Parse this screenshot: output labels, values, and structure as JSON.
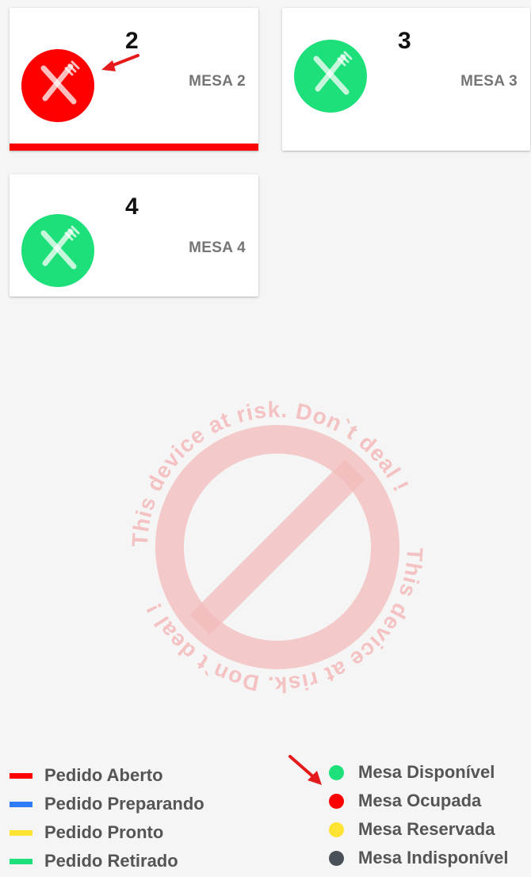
{
  "tables": [
    {
      "number": "2",
      "label": "MESA 2",
      "status_color": "#ff0000",
      "order_bar_color": "#ff0000",
      "icon": "fork-knife-icon"
    },
    {
      "number": "3",
      "label": "MESA 3",
      "status_color": "#1de07a",
      "icon": "fork-knife-icon"
    },
    {
      "number": "4",
      "label": "MESA 4",
      "status_color": "#1de07a",
      "icon": "fork-knife-icon"
    }
  ],
  "watermark": {
    "text": "This device at risk. Don`t deal !",
    "icon": "prohibited-icon",
    "color": "#f3b9b9"
  },
  "legend_orders": [
    {
      "label": "Pedido Aberto",
      "color": "#ff0000"
    },
    {
      "label": "Pedido Preparando",
      "color": "#2f7df6"
    },
    {
      "label": "Pedido Pronto",
      "color": "#ffe333"
    },
    {
      "label": "Pedido Retirado",
      "color": "#1de07a"
    }
  ],
  "legend_tables": [
    {
      "label": "Mesa Disponível",
      "color": "#1de07a"
    },
    {
      "label": "Mesa Ocupada",
      "color": "#ff0000"
    },
    {
      "label": "Mesa Reservada",
      "color": "#ffe333"
    },
    {
      "label": "Mesa Indisponível",
      "color": "#4a5058"
    }
  ],
  "annotation_color": "#e51b1b"
}
